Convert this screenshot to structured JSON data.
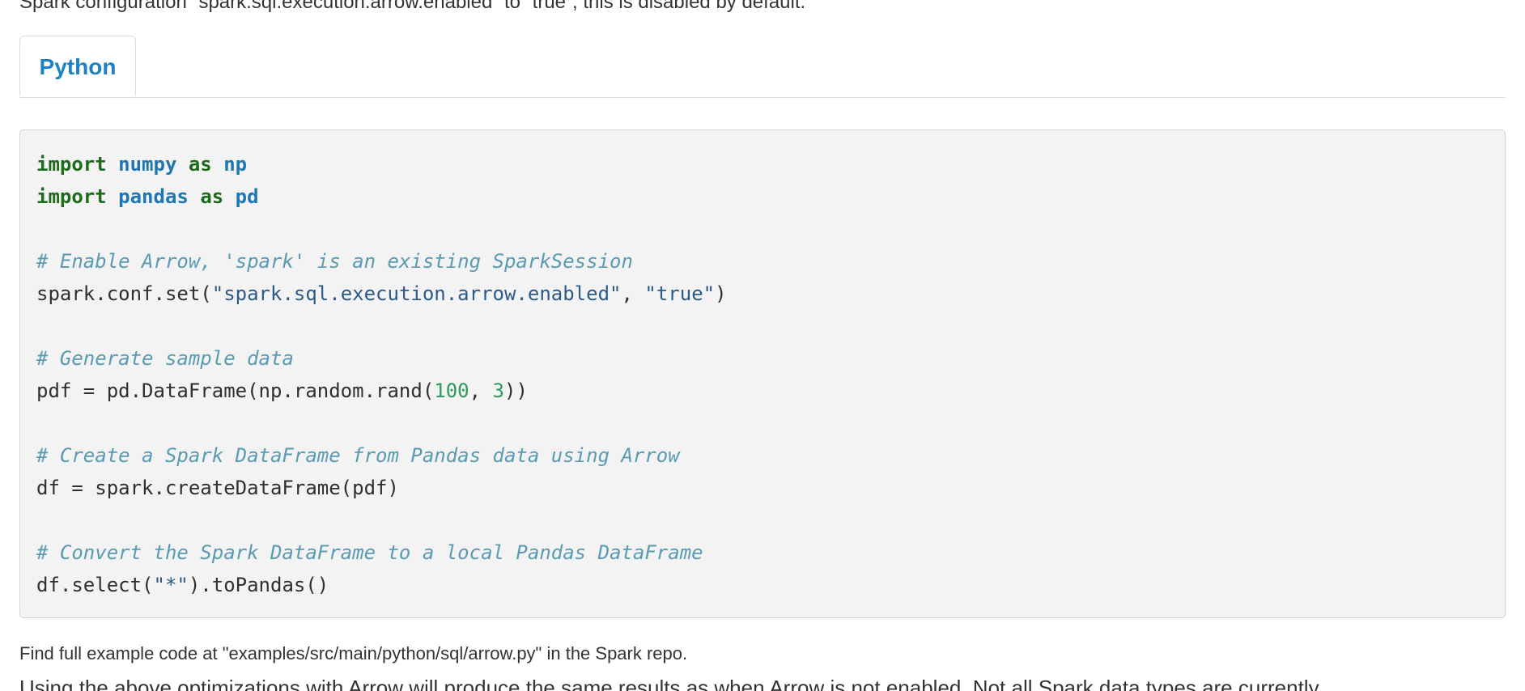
{
  "intro": {
    "text": "Spark configuration `spark.sql.execution.arrow.enabled` to `true`, this is disabled by default."
  },
  "tabs": [
    {
      "label": "Python",
      "active": true
    }
  ],
  "code": {
    "lines": [
      [
        {
          "text": "import",
          "type": "kw"
        },
        {
          "text": " "
        },
        {
          "text": "numpy",
          "type": "mod"
        },
        {
          "text": " "
        },
        {
          "text": "as",
          "type": "kw"
        },
        {
          "text": " "
        },
        {
          "text": "np",
          "type": "mod"
        }
      ],
      [
        {
          "text": "import",
          "type": "kw"
        },
        {
          "text": " "
        },
        {
          "text": "pandas",
          "type": "mod"
        },
        {
          "text": " "
        },
        {
          "text": "as",
          "type": "kw"
        },
        {
          "text": " "
        },
        {
          "text": "pd",
          "type": "mod"
        }
      ],
      [],
      [
        {
          "text": "# Enable Arrow, 'spark' is an existing SparkSession",
          "type": "cmt"
        }
      ],
      [
        {
          "text": "spark.conf.set("
        },
        {
          "text": "\"spark.sql.execution.arrow.enabled\"",
          "type": "str"
        },
        {
          "text": ", "
        },
        {
          "text": "\"true\"",
          "type": "str"
        },
        {
          "text": ")"
        }
      ],
      [],
      [
        {
          "text": "# Generate sample data",
          "type": "cmt"
        }
      ],
      [
        {
          "text": "pdf = pd.DataFrame(np.random.rand("
        },
        {
          "text": "100",
          "type": "num"
        },
        {
          "text": ", "
        },
        {
          "text": "3",
          "type": "num"
        },
        {
          "text": "))"
        }
      ],
      [],
      [
        {
          "text": "# Create a Spark DataFrame from Pandas data using Arrow",
          "type": "cmt"
        }
      ],
      [
        {
          "text": "df = spark.createDataFrame(pdf)"
        }
      ],
      [],
      [
        {
          "text": "# Convert the Spark DataFrame to a local Pandas DataFrame",
          "type": "cmt"
        }
      ],
      [
        {
          "text": "df.select("
        },
        {
          "text": "\"*\"",
          "type": "str"
        },
        {
          "text": ").toPandas()"
        }
      ]
    ]
  },
  "footer_note": {
    "text": "Find full example code at \"examples/src/main/python/sql/arrow.py\" in the Spark repo."
  },
  "bottom": {
    "text": "Using the above optimizations with Arrow will produce the same results as when Arrow is not enabled. Not all Spark data types are currently"
  },
  "colors": {
    "tab_label": "#1d82c4",
    "keyword": "#1e6b1e",
    "module": "#1f77b0",
    "comment": "#5a9bb2",
    "string": "#2b5a88",
    "number": "#2e9a5c",
    "code_bg": "#f3f3f3"
  }
}
